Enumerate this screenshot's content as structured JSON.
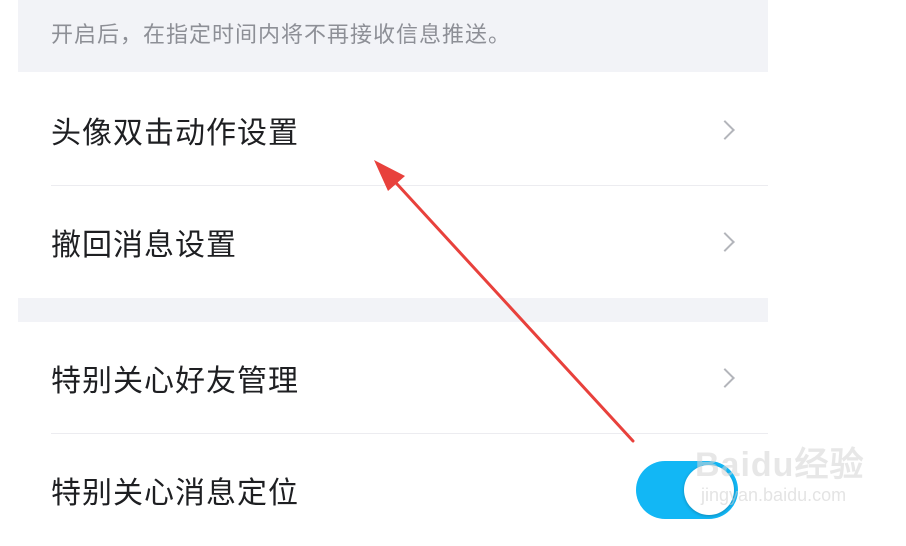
{
  "settings": {
    "hint": "开启后，在指定时间内将不再接收信息推送。",
    "items": [
      {
        "label": "头像双击动作设置",
        "control": "chevron"
      },
      {
        "label": "撤回消息设置",
        "control": "chevron"
      },
      {
        "label": "特别关心好友管理",
        "control": "chevron"
      },
      {
        "label": "特别关心消息定位",
        "control": "toggle",
        "toggle_on": true
      }
    ]
  },
  "icons": {
    "chevron": "chevron-right-icon",
    "arrow": "annotation-arrow"
  },
  "colors": {
    "toggle_on": "#12b7f5",
    "annotation_arrow": "#e8413c",
    "section_background": "#f2f3f7",
    "label_text": "#1e1f22",
    "hint_text": "#8d8f96"
  },
  "watermark": {
    "brand": "Baidu经验",
    "url": "jingyan.baidu.com"
  }
}
